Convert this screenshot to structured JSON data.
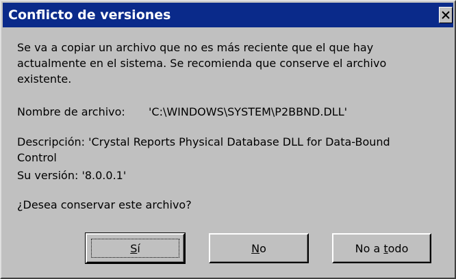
{
  "dialog": {
    "title": "Conflicto de versiones",
    "close_icon": "close-icon"
  },
  "message": {
    "line1": "Se va a copiar un archivo que no es más reciente que el que hay",
    "line2": "actualmente en el sistema. Se recomienda que conserve el archivo",
    "line3": "existente."
  },
  "file": {
    "name_label": "Nombre de archivo:",
    "name_value": "'C:\\WINDOWS\\SYSTEM\\P2BBND.DLL'",
    "description_line1": "Descripción:  'Crystal Reports Physical Database DLL for Data-Bound",
    "description_line2": "Control",
    "version": "Su versión: '8.0.0.1'"
  },
  "question": "¿Desea conservar este archivo?",
  "buttons": {
    "yes": {
      "pre": "",
      "mnemonic": "S",
      "post": "í"
    },
    "no": {
      "pre": "",
      "mnemonic": "N",
      "post": "o"
    },
    "no_to_all": {
      "pre": "No a ",
      "mnemonic": "t",
      "post": "odo"
    }
  }
}
